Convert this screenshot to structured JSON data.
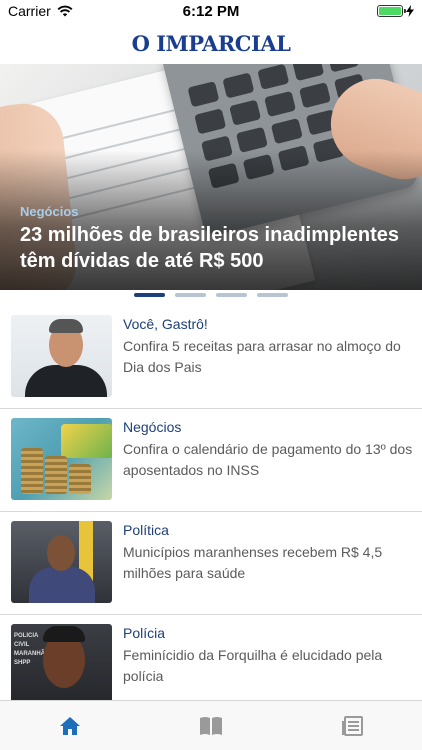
{
  "status_bar": {
    "carrier": "Carrier",
    "time": "6:12 PM",
    "battery_level": 1.0
  },
  "header": {
    "logo_text": "O IMPARCIAL",
    "logo_color": "#1a3d8f"
  },
  "hero": {
    "category": "Negócios",
    "title": "23 milhões de brasileiros inadimplentes têm dívidas de até R$ 500"
  },
  "pager": {
    "count": 4,
    "active_index": 0
  },
  "news": [
    {
      "category": "Você, Gastrô!",
      "headline": "Confira 5 receitas para arrasar no almoço do Dia dos Pais"
    },
    {
      "category": "Negócios",
      "headline": "Confira o calendário de pagamento do 13º dos aposentados no INSS"
    },
    {
      "category": "Política",
      "headline": "Municípios maranhenses recebem R$ 4,5 milhões para saúde"
    },
    {
      "category": "Polícia",
      "headline": "Feminícidio da Forquilha é elucidado pela polícia"
    }
  ],
  "thumb_text": {
    "police_sign": "POLICIA CIVIL MARANHÃO SHPP"
  },
  "tab_bar": {
    "items": [
      {
        "icon": "home-icon",
        "active": true
      },
      {
        "icon": "book-icon",
        "active": false
      },
      {
        "icon": "newspaper-icon",
        "active": false
      }
    ],
    "active_color": "#1d6fb8",
    "inactive_color": "#9a9a9a"
  },
  "colors": {
    "accent": "#1d3f7a",
    "hero_category": "#a9cde8"
  }
}
